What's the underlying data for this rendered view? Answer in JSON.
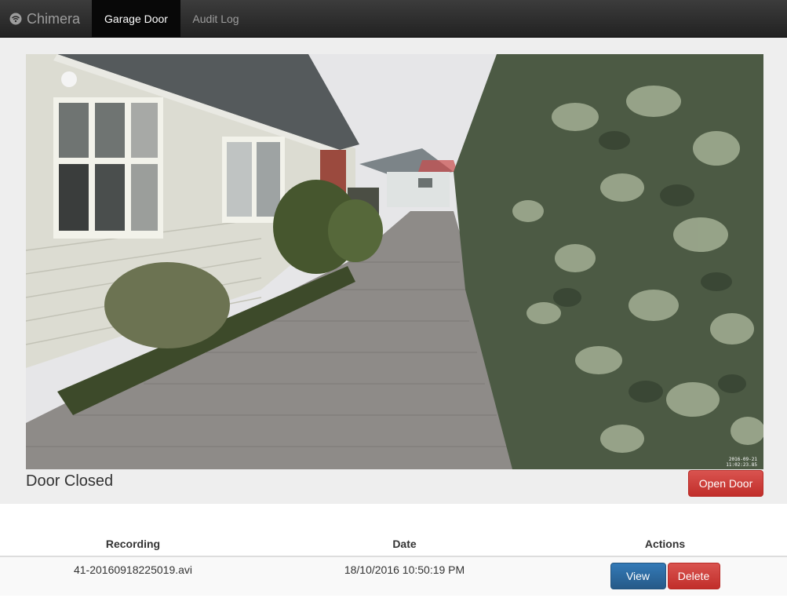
{
  "navbar": {
    "brand": "Chimera",
    "brand_icon": "wifi-icon",
    "tabs": [
      {
        "label": "Garage Door",
        "active": true
      },
      {
        "label": "Audit Log",
        "active": false
      }
    ]
  },
  "camera": {
    "description_icon": "camera-feed-image",
    "timestamp_lines": [
      "2016-09-21",
      "11:02:23.85"
    ]
  },
  "door": {
    "status": "Door Closed",
    "action_label": "Open Door"
  },
  "recordings": {
    "headers": [
      "Recording",
      "Date",
      "Actions"
    ],
    "rows": [
      {
        "file": "41-20160918225019.avi",
        "date": "18/10/2016 10:50:19 PM",
        "view_label": "View",
        "delete_label": "Delete"
      }
    ]
  },
  "colors": {
    "primary": "#337ab7",
    "danger": "#d9534f",
    "navbar": "#222222",
    "jumbotron": "#eeeeee"
  }
}
